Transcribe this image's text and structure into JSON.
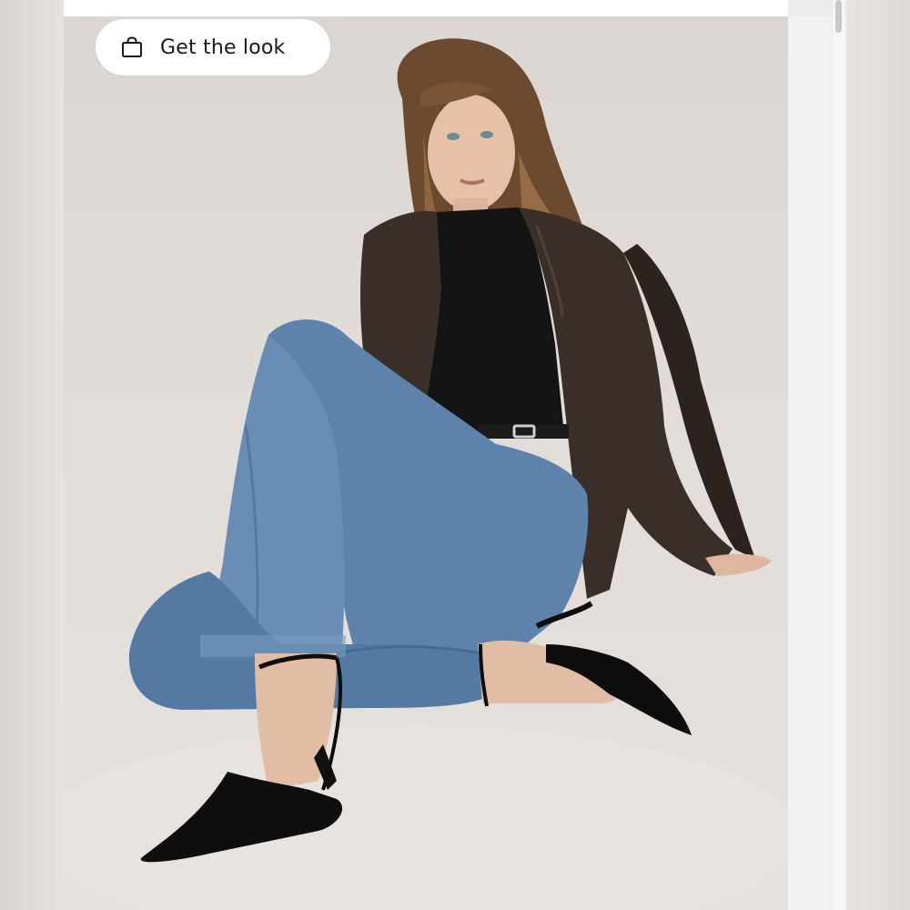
{
  "look_button": {
    "label": "Get the look",
    "icon": "shopping-bag-icon"
  },
  "photo": {
    "subject": "fashion-model-seated"
  },
  "colors": {
    "background": "#e4dfdb",
    "denim": "#5a7fa8",
    "jacket": "#3a2e28",
    "top": "#121212",
    "shoes": "#0e0e0e",
    "button_bg": "#ffffff",
    "button_text": "#1a1a1a"
  }
}
